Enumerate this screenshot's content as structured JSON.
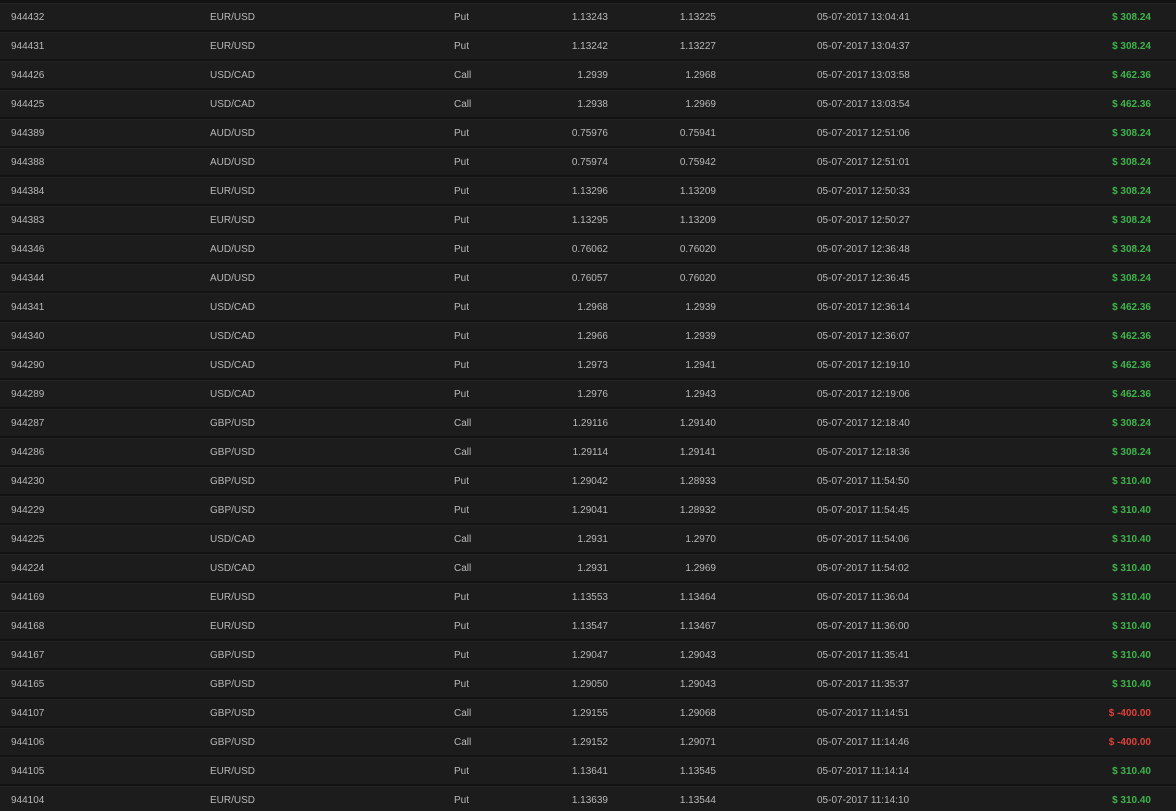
{
  "colors": {
    "background": "#121212",
    "row_background": "#1c1c1c",
    "text": "#b8b8b8",
    "positive": "#3cb54a",
    "negative": "#e0413a"
  },
  "trades": [
    {
      "id": "944432",
      "asset": "EUR/USD",
      "direction": "Put",
      "open": "1.13243",
      "close": "1.13225",
      "time": "05-07-2017 13:04:41",
      "payout": "$ 308.24",
      "status": "win"
    },
    {
      "id": "944431",
      "asset": "EUR/USD",
      "direction": "Put",
      "open": "1.13242",
      "close": "1.13227",
      "time": "05-07-2017 13:04:37",
      "payout": "$ 308.24",
      "status": "win"
    },
    {
      "id": "944426",
      "asset": "USD/CAD",
      "direction": "Call",
      "open": "1.2939",
      "close": "1.2968",
      "time": "05-07-2017 13:03:58",
      "payout": "$ 462.36",
      "status": "win"
    },
    {
      "id": "944425",
      "asset": "USD/CAD",
      "direction": "Call",
      "open": "1.2938",
      "close": "1.2969",
      "time": "05-07-2017 13:03:54",
      "payout": "$ 462.36",
      "status": "win"
    },
    {
      "id": "944389",
      "asset": "AUD/USD",
      "direction": "Put",
      "open": "0.75976",
      "close": "0.75941",
      "time": "05-07-2017 12:51:06",
      "payout": "$ 308.24",
      "status": "win"
    },
    {
      "id": "944388",
      "asset": "AUD/USD",
      "direction": "Put",
      "open": "0.75974",
      "close": "0.75942",
      "time": "05-07-2017 12:51:01",
      "payout": "$ 308.24",
      "status": "win"
    },
    {
      "id": "944384",
      "asset": "EUR/USD",
      "direction": "Put",
      "open": "1.13296",
      "close": "1.13209",
      "time": "05-07-2017 12:50:33",
      "payout": "$ 308.24",
      "status": "win"
    },
    {
      "id": "944383",
      "asset": "EUR/USD",
      "direction": "Put",
      "open": "1.13295",
      "close": "1.13209",
      "time": "05-07-2017 12:50:27",
      "payout": "$ 308.24",
      "status": "win"
    },
    {
      "id": "944346",
      "asset": "AUD/USD",
      "direction": "Put",
      "open": "0.76062",
      "close": "0.76020",
      "time": "05-07-2017 12:36:48",
      "payout": "$ 308.24",
      "status": "win"
    },
    {
      "id": "944344",
      "asset": "AUD/USD",
      "direction": "Put",
      "open": "0.76057",
      "close": "0.76020",
      "time": "05-07-2017 12:36:45",
      "payout": "$ 308.24",
      "status": "win"
    },
    {
      "id": "944341",
      "asset": "USD/CAD",
      "direction": "Put",
      "open": "1.2968",
      "close": "1.2939",
      "time": "05-07-2017 12:36:14",
      "payout": "$ 462.36",
      "status": "win"
    },
    {
      "id": "944340",
      "asset": "USD/CAD",
      "direction": "Put",
      "open": "1.2966",
      "close": "1.2939",
      "time": "05-07-2017 12:36:07",
      "payout": "$ 462.36",
      "status": "win"
    },
    {
      "id": "944290",
      "asset": "USD/CAD",
      "direction": "Put",
      "open": "1.2973",
      "close": "1.2941",
      "time": "05-07-2017 12:19:10",
      "payout": "$ 462.36",
      "status": "win"
    },
    {
      "id": "944289",
      "asset": "USD/CAD",
      "direction": "Put",
      "open": "1.2976",
      "close": "1.2943",
      "time": "05-07-2017 12:19:06",
      "payout": "$ 462.36",
      "status": "win"
    },
    {
      "id": "944287",
      "asset": "GBP/USD",
      "direction": "Call",
      "open": "1.29116",
      "close": "1.29140",
      "time": "05-07-2017 12:18:40",
      "payout": "$ 308.24",
      "status": "win"
    },
    {
      "id": "944286",
      "asset": "GBP/USD",
      "direction": "Call",
      "open": "1.29114",
      "close": "1.29141",
      "time": "05-07-2017 12:18:36",
      "payout": "$ 308.24",
      "status": "win"
    },
    {
      "id": "944230",
      "asset": "GBP/USD",
      "direction": "Put",
      "open": "1.29042",
      "close": "1.28933",
      "time": "05-07-2017 11:54:50",
      "payout": "$ 310.40",
      "status": "win"
    },
    {
      "id": "944229",
      "asset": "GBP/USD",
      "direction": "Put",
      "open": "1.29041",
      "close": "1.28932",
      "time": "05-07-2017 11:54:45",
      "payout": "$ 310.40",
      "status": "win"
    },
    {
      "id": "944225",
      "asset": "USD/CAD",
      "direction": "Call",
      "open": "1.2931",
      "close": "1.2970",
      "time": "05-07-2017 11:54:06",
      "payout": "$ 310.40",
      "status": "win"
    },
    {
      "id": "944224",
      "asset": "USD/CAD",
      "direction": "Call",
      "open": "1.2931",
      "close": "1.2969",
      "time": "05-07-2017 11:54:02",
      "payout": "$ 310.40",
      "status": "win"
    },
    {
      "id": "944169",
      "asset": "EUR/USD",
      "direction": "Put",
      "open": "1.13553",
      "close": "1.13464",
      "time": "05-07-2017 11:36:04",
      "payout": "$ 310.40",
      "status": "win"
    },
    {
      "id": "944168",
      "asset": "EUR/USD",
      "direction": "Put",
      "open": "1.13547",
      "close": "1.13467",
      "time": "05-07-2017 11:36:00",
      "payout": "$ 310.40",
      "status": "win"
    },
    {
      "id": "944167",
      "asset": "GBP/USD",
      "direction": "Put",
      "open": "1.29047",
      "close": "1.29043",
      "time": "05-07-2017 11:35:41",
      "payout": "$ 310.40",
      "status": "win"
    },
    {
      "id": "944165",
      "asset": "GBP/USD",
      "direction": "Put",
      "open": "1.29050",
      "close": "1.29043",
      "time": "05-07-2017 11:35:37",
      "payout": "$ 310.40",
      "status": "win"
    },
    {
      "id": "944107",
      "asset": "GBP/USD",
      "direction": "Call",
      "open": "1.29155",
      "close": "1.29068",
      "time": "05-07-2017 11:14:51",
      "payout": "$ -400.00",
      "status": "loss"
    },
    {
      "id": "944106",
      "asset": "GBP/USD",
      "direction": "Call",
      "open": "1.29152",
      "close": "1.29071",
      "time": "05-07-2017 11:14:46",
      "payout": "$ -400.00",
      "status": "loss"
    },
    {
      "id": "944105",
      "asset": "EUR/USD",
      "direction": "Put",
      "open": "1.13641",
      "close": "1.13545",
      "time": "05-07-2017 11:14:14",
      "payout": "$ 310.40",
      "status": "win"
    },
    {
      "id": "944104",
      "asset": "EUR/USD",
      "direction": "Put",
      "open": "1.13639",
      "close": "1.13544",
      "time": "05-07-2017 11:14:10",
      "payout": "$ 310.40",
      "status": "win"
    }
  ]
}
